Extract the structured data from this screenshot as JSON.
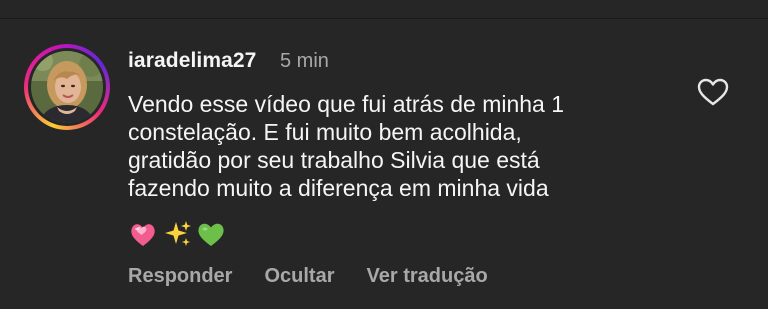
{
  "comment": {
    "username": "iaradelima27",
    "timestamp": "5 min",
    "text_lines": [
      "Vendo esse vídeo que fui atrás de minha 1",
      "constelação. E fui muito bem acolhida,",
      "gratidão por seu trabalho Silvia que está",
      "fazendo muito a diferença em minha vida"
    ],
    "emojis": [
      "💞",
      "✨",
      "💚"
    ],
    "liked": false
  },
  "actions": {
    "reply_label": "Responder",
    "hide_label": "Ocultar",
    "translate_label": "Ver tradução"
  },
  "icons": {
    "like": "heart-outline-icon",
    "avatar": "profile-avatar"
  },
  "colors": {
    "background": "#262626",
    "primary_text": "#f5f5f5",
    "secondary_text": "#a8a8a8",
    "story_ring_start": "#f9ce34",
    "story_ring_mid": "#ee2a7b",
    "story_ring_end": "#6228d7"
  }
}
